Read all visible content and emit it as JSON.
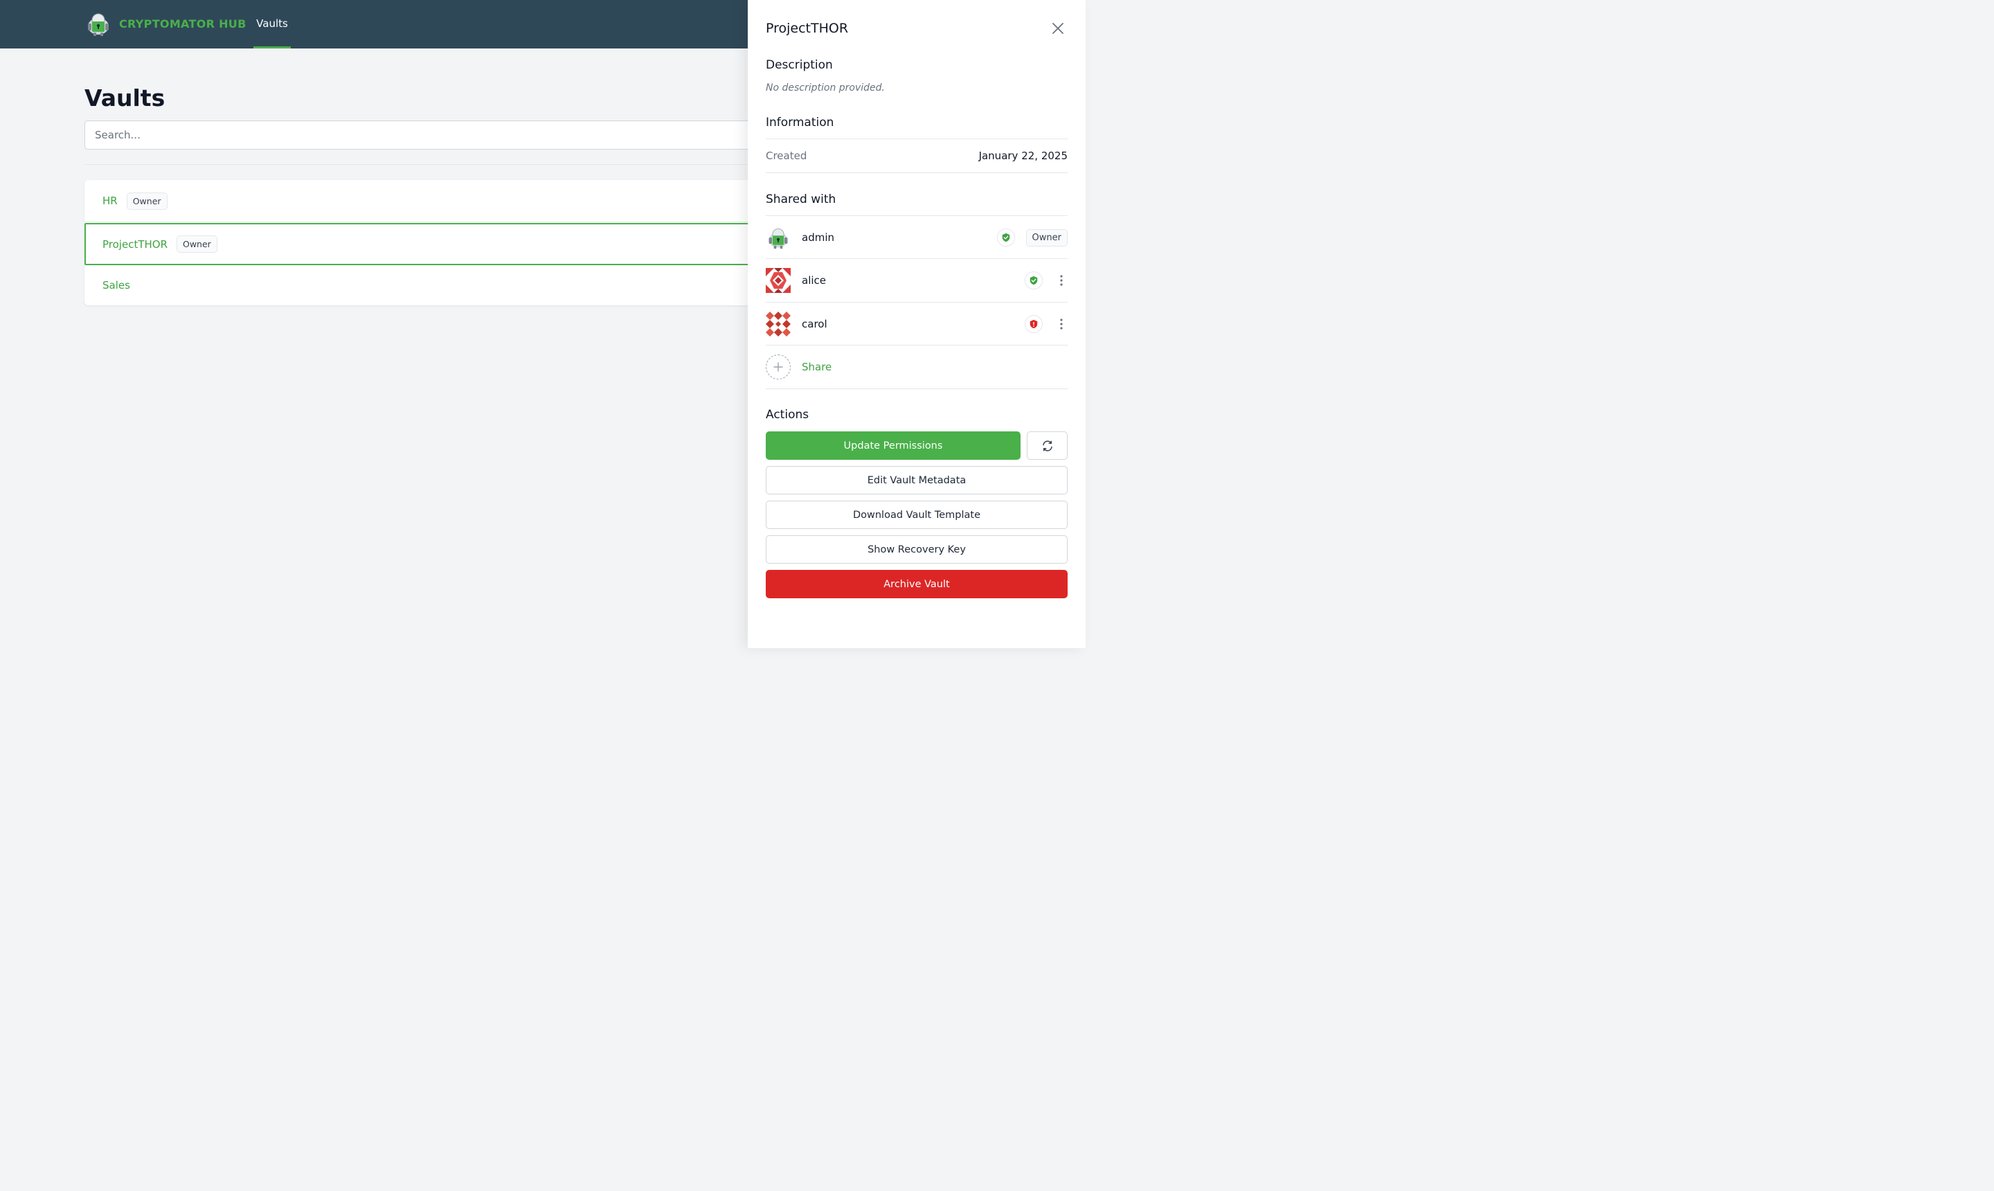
{
  "nav": {
    "brand": "CRYPTOMATOR HUB",
    "tab_vaults": "Vaults"
  },
  "main": {
    "title": "Vaults",
    "search_placeholder": "Search...",
    "vaults": [
      {
        "name": "HR",
        "badge": "Owner"
      },
      {
        "name": "ProjectTHOR",
        "badge": "Owner",
        "selected": true
      },
      {
        "name": "Sales"
      }
    ]
  },
  "panel": {
    "title": "ProjectTHOR",
    "description_heading": "Description",
    "description": "No description provided.",
    "information_heading": "Information",
    "created_label": "Created",
    "created_value": "January 22, 2025",
    "shared_heading": "Shared with",
    "members": [
      {
        "name": "admin",
        "status": "verified",
        "role": "Owner"
      },
      {
        "name": "alice",
        "status": "verified"
      },
      {
        "name": "carol",
        "status": "unverified"
      }
    ],
    "share_label": "Share",
    "actions_heading": "Actions",
    "actions": {
      "update_permissions": "Update Permissions",
      "edit_metadata": "Edit Vault Metadata",
      "download_template": "Download Vault Template",
      "show_recovery_key": "Show Recovery Key",
      "archive_vault": "Archive Vault"
    }
  },
  "colors": {
    "nav_bg": "#2f4858",
    "accent_green": "#49b04a",
    "danger_red": "#dc2626"
  },
  "icons": [
    "cryptomator-bot-icon",
    "close-icon",
    "shield-check-icon",
    "shield-alert-icon",
    "more-vertical-icon",
    "plus-icon",
    "refresh-icon"
  ]
}
